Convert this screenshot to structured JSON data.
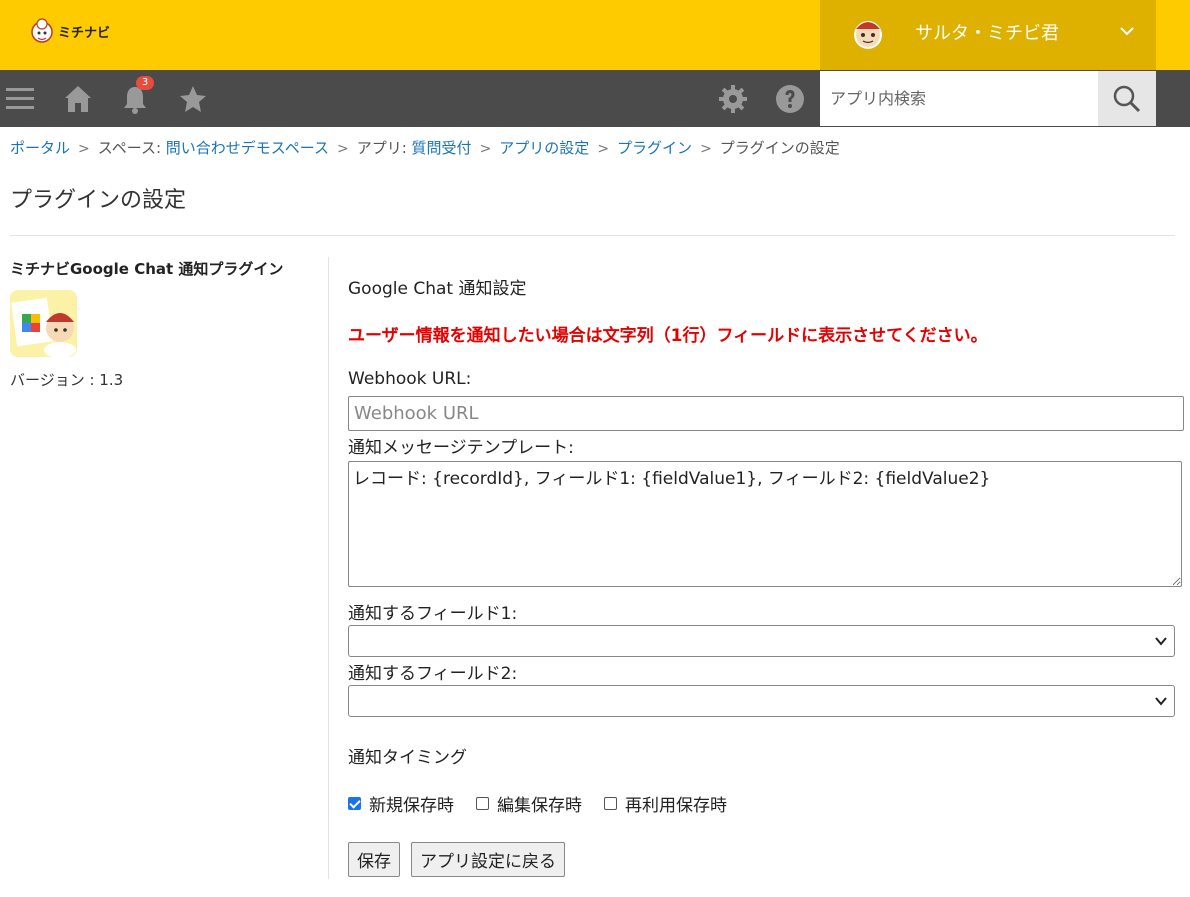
{
  "header": {
    "logo_text": "ミチナビ",
    "user_name": "サルタ・ミチビ君"
  },
  "nav": {
    "notification_count": "3",
    "search_placeholder": "アプリ内検索"
  },
  "breadcrumb": {
    "items": [
      "ポータル",
      "スペース: 問い合わせデモスペース",
      "アプリ: 質問受付",
      "アプリの設定",
      "プラグイン",
      "プラグインの設定"
    ],
    "separator": ">"
  },
  "page_title": "プラグインの設定",
  "plugin": {
    "name": "ミチナビGoogle Chat 通知プラグイン",
    "version": "バージョン : 1.3"
  },
  "settings": {
    "section_title": "Google Chat 通知設定",
    "warning": "ユーザー情報を通知したい場合は文字列（1行）フィールドに表示させてください。",
    "webhook_label": "Webhook URL:",
    "webhook_placeholder": "Webhook URL",
    "template_label": "通知メッセージテンプレート:",
    "template_value": "レコード: {recordId}, フィールド1: {fieldValue1}, フィールド2: {fieldValue2}",
    "field1_label": "通知するフィールド1:",
    "field1_value": "",
    "field2_label": "通知するフィールド2:",
    "field2_value": "",
    "timing_title": "通知タイミング",
    "timing_options": [
      {
        "label": "新規保存時",
        "checked": true
      },
      {
        "label": "編集保存時",
        "checked": false
      },
      {
        "label": "再利用保存時",
        "checked": false
      }
    ],
    "save_label": "保存",
    "back_label": "アプリ設定に戻る"
  },
  "colors": {
    "header_bg": "#fecb00",
    "user_bg": "#deb100",
    "nav_bg": "#4b4b4b",
    "link": "#1a74b9",
    "warning": "#e60000"
  }
}
